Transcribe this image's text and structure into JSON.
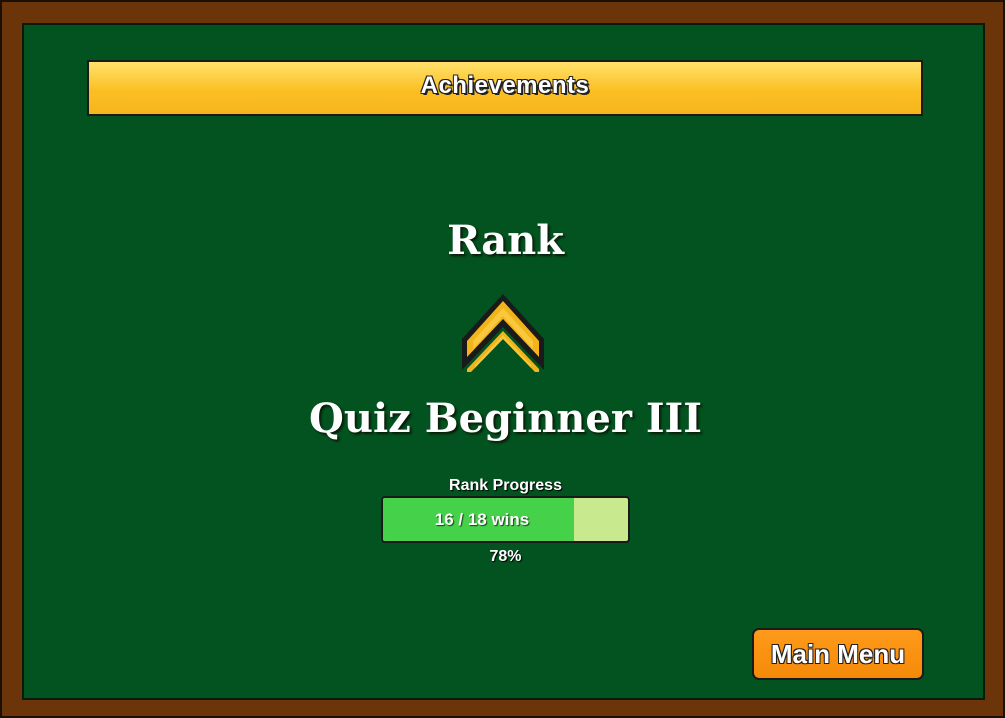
{
  "header": {
    "title": "Achievements"
  },
  "rank": {
    "heading": "Rank",
    "insignia_icon": "chevron-rank-insignia-icon",
    "name": "Quiz Beginner III"
  },
  "progress": {
    "label": "Rank Progress",
    "wins_text": "16 / 18 wins",
    "current_wins": 16,
    "required_wins": 18,
    "percent_text": "78%",
    "fill_fraction": 0.78
  },
  "footer": {
    "main_menu_label": "Main Menu"
  },
  "colors": {
    "frame": "#6b3409",
    "board": "#02531f",
    "title_bar": "#fbbf24",
    "progress_fill": "#46d14b",
    "progress_track": "#c9e98f",
    "button": "#f58a08"
  }
}
